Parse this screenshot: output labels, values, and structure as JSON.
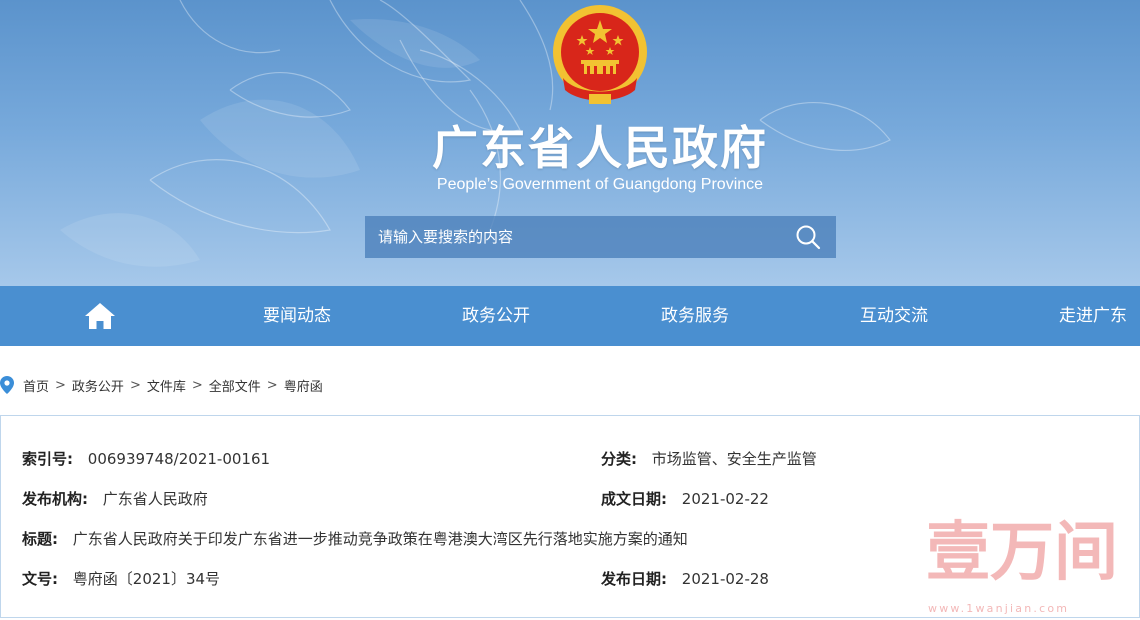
{
  "header": {
    "title": "广东省人民政府",
    "subtitle": "People’s Government of Guangdong Province",
    "emblem_icon": "national-emblem-icon"
  },
  "search": {
    "placeholder": "请输入要搜索的内容",
    "icon": "search-icon"
  },
  "nav": {
    "home_icon": "home-icon",
    "items": [
      {
        "label": "要闻动态"
      },
      {
        "label": "政务公开"
      },
      {
        "label": "政务服务"
      },
      {
        "label": "互动交流"
      },
      {
        "label": "走进广东"
      }
    ]
  },
  "breadcrumb": {
    "icon": "location-pin-icon",
    "items": [
      "首页",
      "政务公开",
      "文件库",
      "全部文件",
      "粤府函"
    ],
    "separator": ">"
  },
  "document": {
    "index_label": "索引号:",
    "index_value": "006939748/2021-00161",
    "category_label": "分类:",
    "category_value": "市场监管、安全生产监管",
    "publisher_label": "发布机构:",
    "publisher_value": "广东省人民政府",
    "created_label": "成文日期:",
    "created_value": "2021-02-22",
    "title_label": "标题:",
    "title_value": "广东省人民政府关于印发广东省进一步推动竞争政策在粤港澳大湾区先行落地实施方案的通知",
    "docno_label": "文号:",
    "docno_value": "粤府函〔2021〕34号",
    "published_label": "发布日期:",
    "published_value": "2021-02-28"
  },
  "watermark": {
    "text": "壹万间",
    "url": "www.1wanjian.com"
  },
  "colors": {
    "banner_top": "#5b93cc",
    "banner_bottom": "#a6c8ea",
    "nav_bg": "#4a8fd0",
    "emblem_red": "#d8261a",
    "emblem_gold": "#f2c232",
    "watermark": "#f3b8b8"
  }
}
